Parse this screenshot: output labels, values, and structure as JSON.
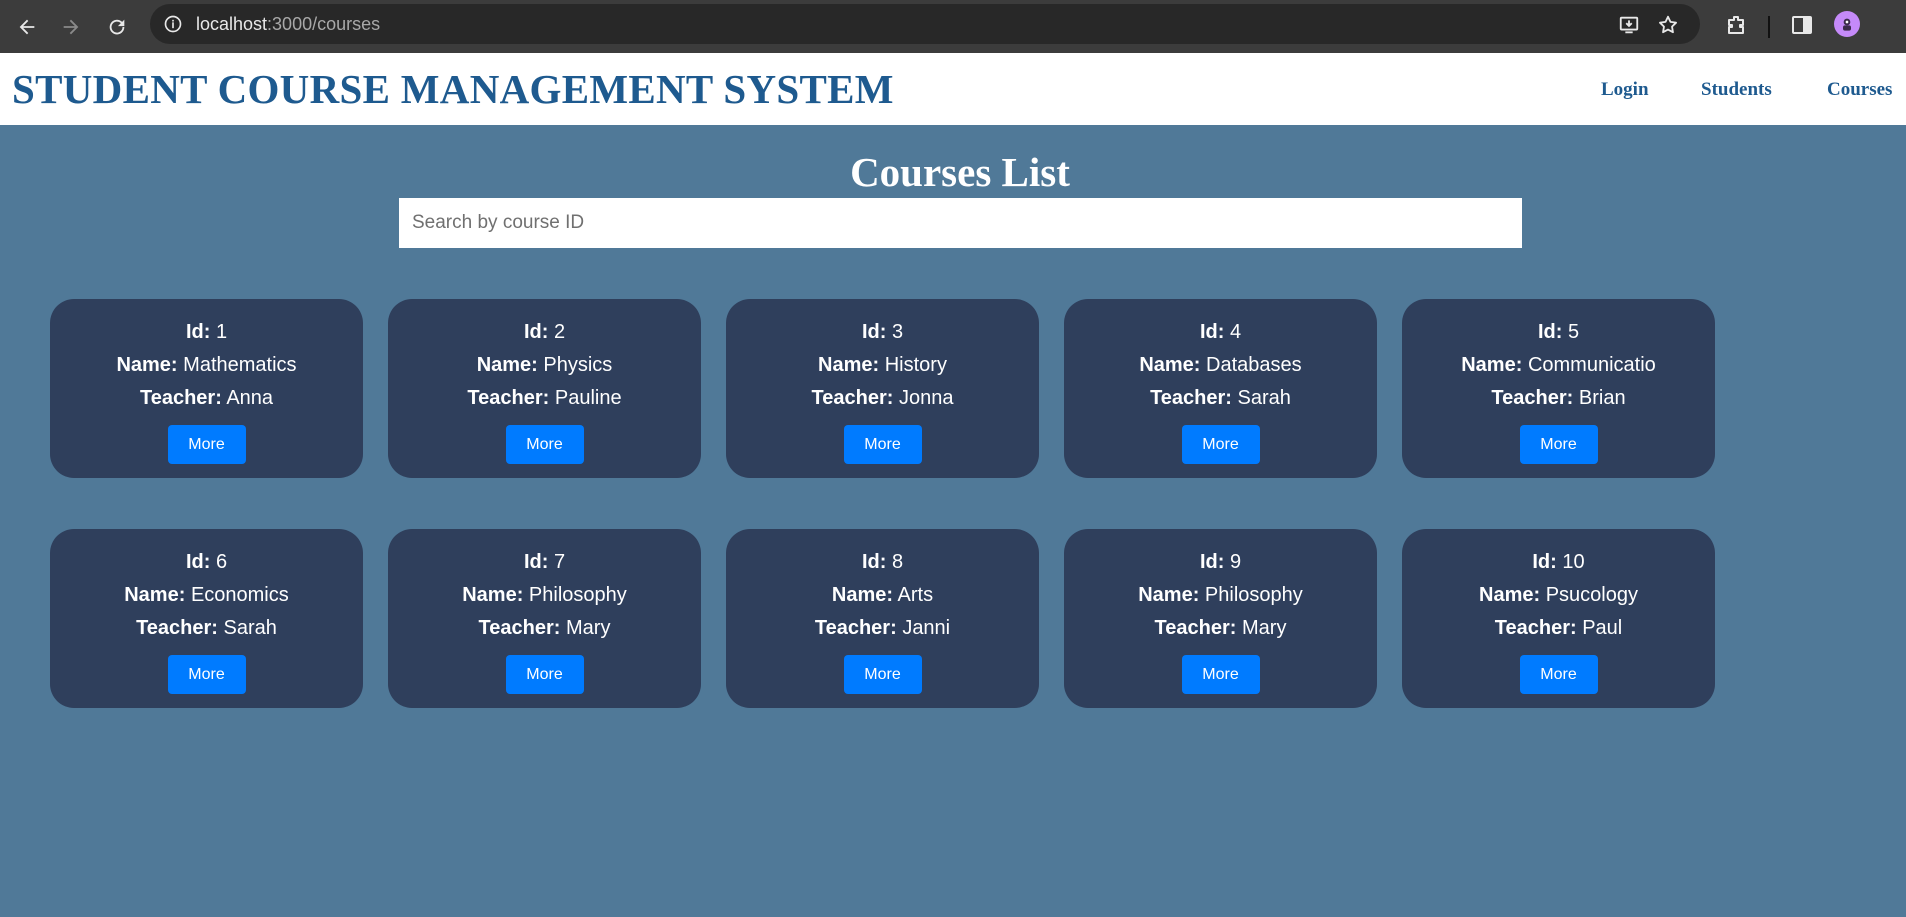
{
  "browser": {
    "url_host": "localhost",
    "url_path": ":3000/courses"
  },
  "header": {
    "title": "STUDENT COURSE MANAGEMENT SYSTEM",
    "nav": [
      "Login",
      "Students",
      "Courses"
    ]
  },
  "main": {
    "heading": "Courses List",
    "search_placeholder": "Search by course ID",
    "labels": {
      "id": "Id:",
      "name": "Name:",
      "teacher": "Teacher:"
    },
    "button_label": "More",
    "courses": [
      {
        "id": "1",
        "name": "Mathematics",
        "teacher": "Anna"
      },
      {
        "id": "2",
        "name": "Physics",
        "teacher": "Pauline"
      },
      {
        "id": "3",
        "name": "History",
        "teacher": "Jonna"
      },
      {
        "id": "4",
        "name": "Databases",
        "teacher": "Sarah"
      },
      {
        "id": "5",
        "name": "Communicatio",
        "teacher": "Brian"
      },
      {
        "id": "6",
        "name": "Economics",
        "teacher": "Sarah"
      },
      {
        "id": "7",
        "name": "Philosophy",
        "teacher": "Mary"
      },
      {
        "id": "8",
        "name": "Arts",
        "teacher": "Janni"
      },
      {
        "id": "9",
        "name": "Philosophy",
        "teacher": "Mary"
      },
      {
        "id": "10",
        "name": "Psucology",
        "teacher": "Paul"
      }
    ]
  },
  "colors": {
    "page_bg": "#507998",
    "card_bg": "#2f3f5c",
    "accent_button": "#007bff",
    "title_blue": "#1e5a8f"
  },
  "icons": [
    "back-arrow-icon",
    "forward-arrow-icon",
    "reload-icon",
    "site-info-icon",
    "install-app-icon",
    "star-icon",
    "extensions-icon",
    "side-panel-icon",
    "profile-avatar-icon"
  ]
}
